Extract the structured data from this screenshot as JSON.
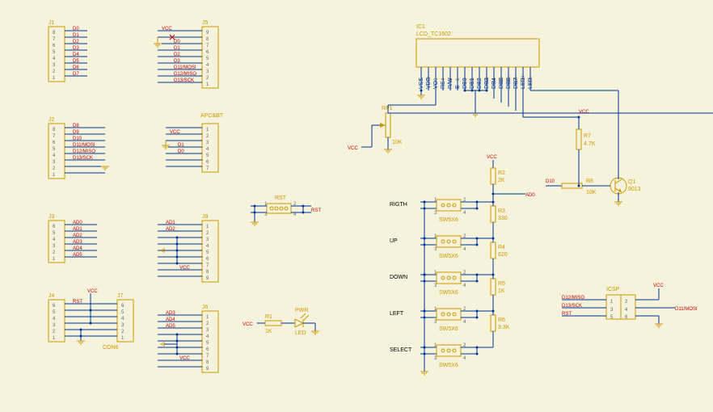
{
  "ic1": {
    "ref": "IC1",
    "part": "LCD_TC1602",
    "pins": [
      "VSS",
      "VDD",
      "VO",
      "RS",
      "R/W",
      "E",
      "DB0",
      "DB1",
      "DB2",
      "DB3",
      "DB4",
      "DB5",
      "DB6",
      "DB7",
      "LED+",
      "LED-"
    ],
    "pin_nums": [
      "1",
      "2",
      "3",
      "4",
      "5",
      "6",
      "7",
      "8",
      "9",
      "10",
      "11",
      "12",
      "13",
      "14",
      "15",
      "16"
    ]
  },
  "headers": {
    "j1": {
      "ref": "J1",
      "pins": [
        "8",
        "7",
        "6",
        "5",
        "4",
        "3",
        "2",
        "1"
      ],
      "nets": [
        "D0",
        "D1",
        "D2",
        "D3",
        "D4",
        "D5",
        "D6",
        "D7"
      ]
    },
    "j2": {
      "ref": "J2",
      "pins": [
        "8",
        "7",
        "6",
        "5",
        "4",
        "3",
        "2",
        "1"
      ],
      "nets": [
        "D8",
        "D9",
        "D10",
        "D11/MOSI",
        "D12/MISO",
        "D13/SCK",
        "",
        ""
      ]
    },
    "j3": {
      "ref": "J3",
      "pins": [
        "6",
        "5",
        "4",
        "3",
        "2",
        "1"
      ],
      "nets": [
        "AD0",
        "AD1",
        "AD2",
        "AD3",
        "AD4",
        "AD5"
      ]
    },
    "j4": {
      "ref": "J4",
      "pins": [
        "6",
        "5",
        "4",
        "3",
        "2",
        "1"
      ],
      "nets": [
        "RST",
        "",
        "",
        "",
        "",
        ""
      ],
      "vcc": "VCC"
    },
    "j5": {
      "ref": "J5",
      "pins": [
        "9",
        "8",
        "7",
        "6",
        "5",
        "4",
        "3",
        "2",
        "1"
      ],
      "nets": [
        "VCC",
        "",
        "D0",
        "D1",
        "D2",
        "D3",
        "D11/MOSI",
        "D12/MISO",
        "D13/SCK"
      ]
    },
    "apc": {
      "ref": "APC&BT",
      "pins": [
        "1",
        "2",
        "3",
        "4",
        "5",
        "6",
        "7"
      ],
      "nets": [
        "",
        "VCC",
        "",
        "D1",
        "D0",
        "",
        ""
      ]
    },
    "j7": {
      "ref": "J7",
      "pins": [
        "6",
        "5",
        "4",
        "3",
        "2",
        "1"
      ],
      "nets": [
        "",
        "",
        "",
        "",
        "",
        ""
      ],
      "label": "CON6"
    },
    "j8": {
      "ref": "J8",
      "pins": [
        "1",
        "2",
        "3",
        "4",
        "5",
        "6",
        "7",
        "8",
        "9"
      ],
      "nets": [
        "AD1",
        "AD2",
        "",
        "",
        "",
        "",
        "",
        "VCC",
        ""
      ]
    },
    "j6": {
      "ref": "J6",
      "pins": [
        "1",
        "2",
        "3",
        "4",
        "5",
        "6",
        "7",
        "8",
        "9"
      ],
      "nets": [
        "AD3",
        "AD4",
        "AD5",
        "",
        "",
        "",
        "",
        "VCC",
        ""
      ]
    }
  },
  "rst_switch": {
    "ref": "RST",
    "net": "RST",
    "pins": [
      "1",
      "3",
      "2",
      "4"
    ]
  },
  "led": {
    "ref1": "R1",
    "val1": "1K",
    "ref2": "PWR",
    "part2": "LED",
    "vcc": "VCC"
  },
  "rp1": {
    "ref": "RP1",
    "val": "10K",
    "vcc": "VCC"
  },
  "buttons": {
    "labels": [
      "RIGTH",
      "UP",
      "DOWN",
      "LEFT",
      "SELECT"
    ],
    "refs": [
      "SW5X6",
      "SW5X6",
      "SW5X6",
      "SW5X6",
      "SW5X6"
    ],
    "pins": [
      "1",
      "3",
      "2",
      "4"
    ]
  },
  "resistors": {
    "r2": {
      "ref": "R2",
      "val": "2K",
      "vcc": "VCC"
    },
    "r3": {
      "ref": "R3",
      "val": "330"
    },
    "r4": {
      "ref": "R4",
      "val": "620"
    },
    "r5": {
      "ref": "R5",
      "val": "1K"
    },
    "r6": {
      "ref": "R6",
      "val": "3.3K"
    },
    "r7": {
      "ref": "R7",
      "val": "4.7K",
      "vcc": "VCC"
    },
    "r8": {
      "ref": "R8",
      "val": "10K"
    }
  },
  "net_ad0": "AD0",
  "net_d10": "D10",
  "q1": {
    "ref": "Q1",
    "part": "9013"
  },
  "icsp": {
    "ref": "ICSP",
    "pins_left": [
      "1",
      "3",
      "5"
    ],
    "pins_right": [
      "2",
      "4",
      "6"
    ],
    "nets_left": [
      "D12/MISO",
      "D13/SCK",
      "RST"
    ],
    "nets_right": [
      "VCC",
      "D11/MOSI",
      ""
    ]
  }
}
